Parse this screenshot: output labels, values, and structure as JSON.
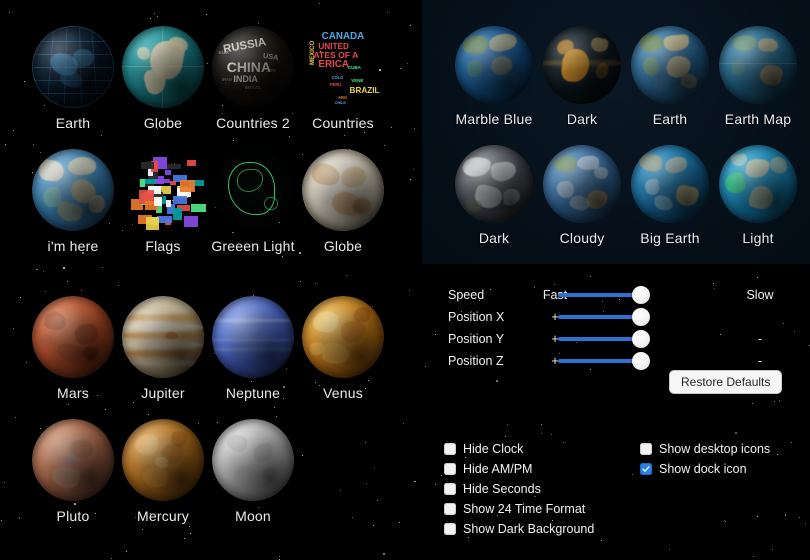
{
  "app": {
    "background_color": "#000000",
    "panel_color": "#061018",
    "accent_color": "#2a72d4",
    "checked_color": "#2a7fe8"
  },
  "globe_themes_left": {
    "rows": [
      [
        {
          "label": "Earth",
          "style": "wire-blue"
        },
        {
          "label": "Globe",
          "style": "teal-cream"
        },
        {
          "label": "Countries 2",
          "style": "typo-dark"
        },
        {
          "label": "Countries",
          "style": "typo-color"
        }
      ],
      [
        {
          "label": "i'm here",
          "style": "blue-terrain"
        },
        {
          "label": "Flags",
          "style": "flags"
        },
        {
          "label": "Greeen Light",
          "style": "green-outline"
        },
        {
          "label": "Globe",
          "style": "vintage-map"
        }
      ]
    ]
  },
  "globe_themes_right": {
    "rows": [
      [
        {
          "label": "Marble Blue",
          "style": "marble-blue"
        },
        {
          "label": "Dark",
          "style": "dark-amber"
        },
        {
          "label": "Earth",
          "style": "earth-natural"
        },
        {
          "label": "Earth Map",
          "style": "earth-map"
        }
      ],
      [
        {
          "label": "Dark",
          "style": "dark-clouds"
        },
        {
          "label": "Cloudy",
          "style": "cloudy"
        },
        {
          "label": "Big Earth",
          "style": "big-earth"
        },
        {
          "label": "Light",
          "style": "light-blue"
        }
      ]
    ]
  },
  "planets": {
    "rows": [
      [
        {
          "label": "Mars",
          "style": "mars"
        },
        {
          "label": "Jupiter",
          "style": "jupiter"
        },
        {
          "label": "Neptune",
          "style": "neptune"
        },
        {
          "label": "Venus",
          "style": "venus"
        }
      ],
      [
        {
          "label": "Pluto",
          "style": "pluto"
        },
        {
          "label": "Mercury",
          "style": "mercury"
        },
        {
          "label": "Moon",
          "style": "moon"
        }
      ]
    ]
  },
  "sliders": [
    {
      "name": "Speed",
      "min_label": "Fast",
      "max_label": "Slow",
      "value_percent": 100
    },
    {
      "name": "Position X",
      "min_label": "+",
      "max_label": "",
      "value_percent": 100
    },
    {
      "name": "Position Y",
      "min_label": "+",
      "max_label": "-",
      "value_percent": 100
    },
    {
      "name": "Position Z",
      "min_label": "+",
      "max_label": "-",
      "value_percent": 100
    }
  ],
  "buttons": {
    "restore_defaults": "Restore Defaults"
  },
  "checkboxes_left": [
    {
      "label": "Hide Clock",
      "checked": false
    },
    {
      "label": "Hide AM/PM",
      "checked": false
    },
    {
      "label": "Hide Seconds",
      "checked": false
    },
    {
      "label": "Show 24 Time Format",
      "checked": false
    },
    {
      "label": "Show Dark Background",
      "checked": false
    }
  ],
  "checkboxes_right": [
    {
      "label": "Show desktop icons",
      "checked": false
    },
    {
      "label": "Show dock icon",
      "checked": true
    }
  ]
}
